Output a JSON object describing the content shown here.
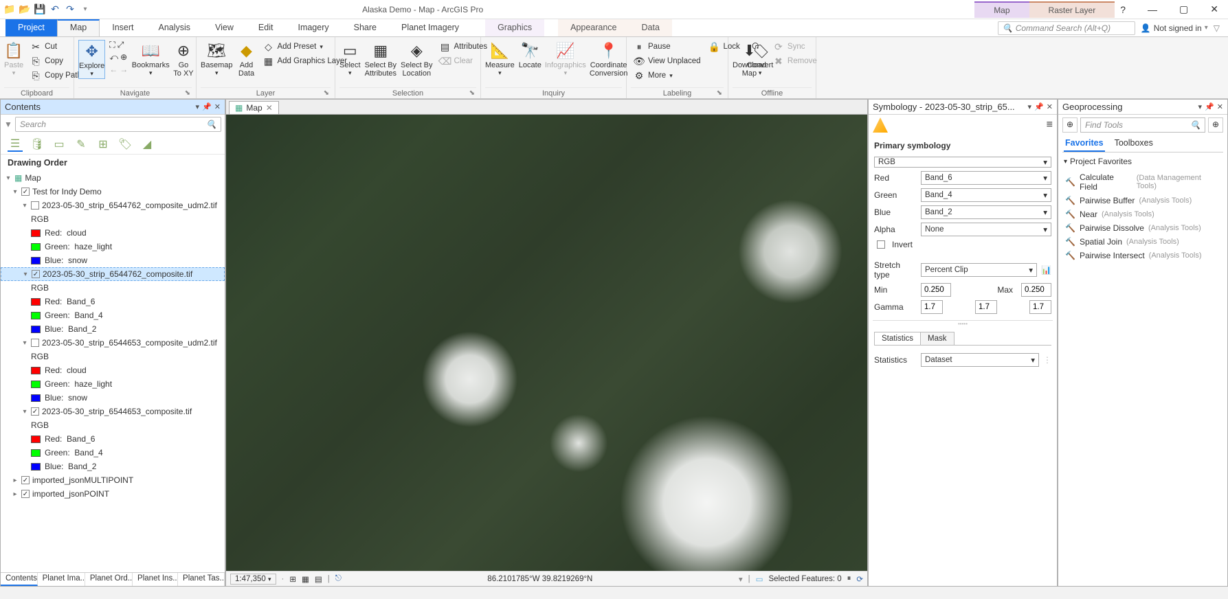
{
  "title": "Alaska Demo - Map - ArcGIS Pro",
  "contextTabs": {
    "map": "Map",
    "raster": "Raster Layer"
  },
  "titleRight": {
    "help": "?",
    "signin": "Not signed in",
    "bell": "🔔"
  },
  "tabs": {
    "file": "Project",
    "map": "Map",
    "insert": "Insert",
    "analysis": "Analysis",
    "view": "View",
    "edit": "Edit",
    "imagery": "Imagery",
    "share": "Share",
    "planet": "Planet Imagery",
    "graphics": "Graphics",
    "appearance": "Appearance",
    "data": "Data",
    "searchPlaceholder": "Command Search (Alt+Q)"
  },
  "ribbon": {
    "clipboard": {
      "paste": "Paste",
      "cut": "Cut",
      "copy": "Copy",
      "copyPath": "Copy Path",
      "label": "Clipboard"
    },
    "navigate": {
      "explore": "Explore",
      "bookmarks": "Bookmarks",
      "goto": "Go\nTo XY",
      "label": "Navigate"
    },
    "layer": {
      "basemap": "Basemap",
      "addData": "Add\nData",
      "addPreset": "Add Preset",
      "addGraphics": "Add Graphics Layer",
      "label": "Layer"
    },
    "selection": {
      "select": "Select",
      "byAttr": "Select By\nAttributes",
      "byLoc": "Select By\nLocation",
      "attributes": "Attributes",
      "clear": "Clear",
      "label": "Selection"
    },
    "inquiry": {
      "measure": "Measure",
      "locate": "Locate",
      "infographics": "Infographics",
      "coord": "Coordinate\nConversion",
      "label": "Inquiry"
    },
    "labeling": {
      "pause": "Pause",
      "lock": "Lock",
      "viewUnplaced": "View Unplaced",
      "more": "More",
      "convert": "Convert",
      "label": "Labeling"
    },
    "offline": {
      "download": "Download\nMap",
      "sync": "Sync",
      "remove": "Remove",
      "label": "Offline"
    }
  },
  "contents": {
    "title": "Contents",
    "searchPlaceholder": "Search",
    "section": "Drawing Order",
    "mapNode": "Map",
    "groupLayer": "Test for Indy Demo",
    "layers": [
      {
        "name": "2023-05-30_strip_6544762_composite_udm2.tif",
        "checked": false,
        "rgb": "RGB",
        "bands": [
          [
            "Red:",
            "cloud"
          ],
          [
            "Green:",
            "haze_light"
          ],
          [
            "Blue:",
            "snow"
          ]
        ]
      },
      {
        "name": "2023-05-30_strip_6544762_composite.tif",
        "checked": true,
        "selected": true,
        "rgb": "RGB",
        "bands": [
          [
            "Red:",
            "Band_6"
          ],
          [
            "Green:",
            "Band_4"
          ],
          [
            "Blue:",
            "Band_2"
          ]
        ]
      },
      {
        "name": "2023-05-30_strip_6544653_composite_udm2.tif",
        "checked": false,
        "rgb": "RGB",
        "bands": [
          [
            "Red:",
            "cloud"
          ],
          [
            "Green:",
            "haze_light"
          ],
          [
            "Blue:",
            "snow"
          ]
        ]
      },
      {
        "name": "2023-05-30_strip_6544653_composite.tif",
        "checked": true,
        "rgb": "RGB",
        "bands": [
          [
            "Red:",
            "Band_6"
          ],
          [
            "Green:",
            "Band_4"
          ],
          [
            "Blue:",
            "Band_2"
          ]
        ]
      }
    ],
    "extra": [
      "imported_jsonMULTIPOINT",
      "imported_jsonPOINT"
    ],
    "bottomTabs": [
      "Contents",
      "Planet Ima...",
      "Planet Ord...",
      "Planet Ins...",
      "Planet Tas..."
    ]
  },
  "mapTab": {
    "name": "Map"
  },
  "mapStatus": {
    "scale": "1:47,350",
    "coords": "86.2101785°W 39.8219269°N",
    "selected": "Selected Features: 0"
  },
  "symbology": {
    "title": "Symbology - 2023-05-30_strip_65...",
    "primary": "Primary symbology",
    "scheme": "RGB",
    "red": "Red",
    "redVal": "Band_6",
    "green": "Green",
    "greenVal": "Band_4",
    "blue": "Blue",
    "blueVal": "Band_2",
    "alpha": "Alpha",
    "alphaVal": "None",
    "invert": "Invert",
    "stretch": "Stretch type",
    "stretchVal": "Percent Clip",
    "min": "Min",
    "minVal": "0.250",
    "max": "Max",
    "maxVal": "0.250",
    "gamma": "Gamma",
    "g1": "1.7",
    "g2": "1.7",
    "g3": "1.7",
    "tabStats": "Statistics",
    "tabMask": "Mask",
    "statsLabel": "Statistics",
    "statsVal": "Dataset"
  },
  "geo": {
    "title": "Geoprocessing",
    "placeholder": "Find Tools",
    "tabFav": "Favorites",
    "tabTool": "Toolboxes",
    "section": "Project Favorites",
    "tools": [
      [
        "Calculate Field",
        "(Data Management Tools)"
      ],
      [
        "Pairwise Buffer",
        "(Analysis Tools)"
      ],
      [
        "Near",
        "(Analysis Tools)"
      ],
      [
        "Pairwise Dissolve",
        "(Analysis Tools)"
      ],
      [
        "Spatial Join",
        "(Analysis Tools)"
      ],
      [
        "Pairwise Intersect",
        "(Analysis Tools)"
      ]
    ]
  }
}
